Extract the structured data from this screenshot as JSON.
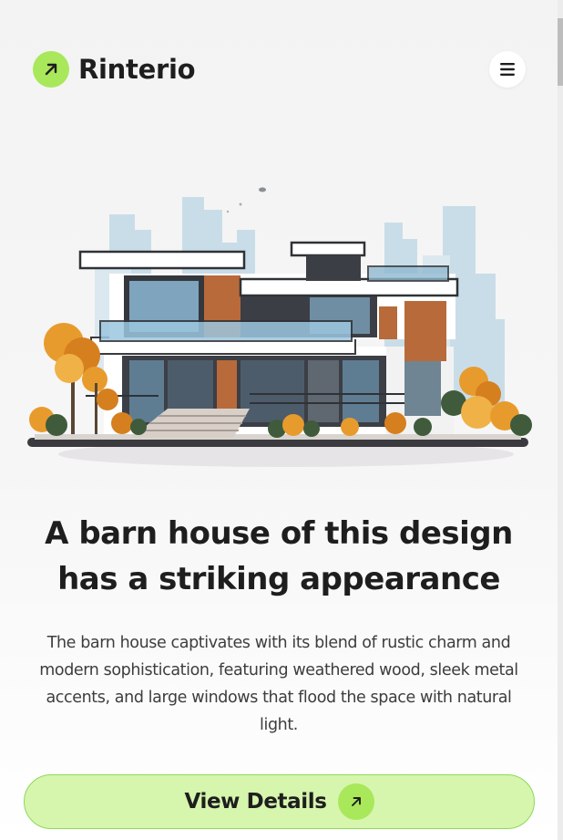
{
  "brand": {
    "name": "Rinterio",
    "logo_icon": "arrow-up-right-icon",
    "accent": "#a8e85a"
  },
  "header": {
    "menu_icon": "hamburger-menu-icon"
  },
  "hero": {
    "illustration": "modern-house-illustration",
    "headline": "A barn house of this design has a striking appearance",
    "description": "The barn house captivates with its blend of rustic charm and modern sophistication, featuring weathered wood, sleek metal accents, and large windows that flood the space with natural light."
  },
  "cta": {
    "label": "View Details",
    "icon": "arrow-up-right-icon",
    "bg": "#d6f5ad"
  }
}
